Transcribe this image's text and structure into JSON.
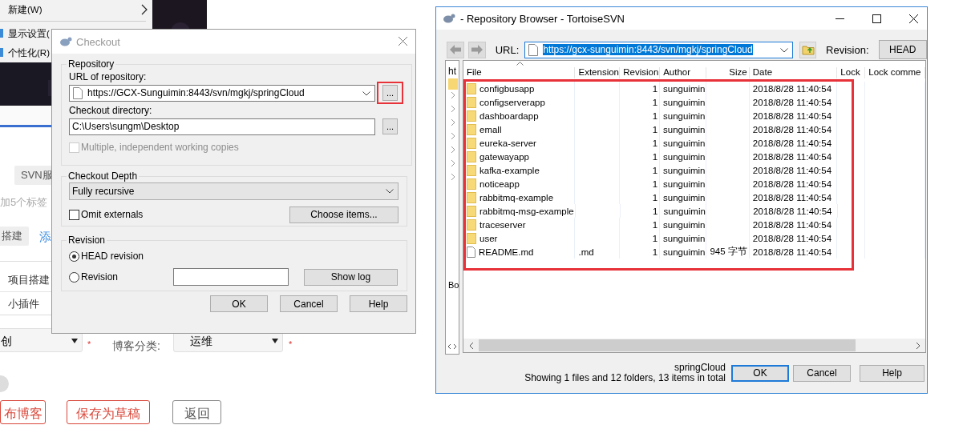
{
  "desktop_menu": {
    "items": [
      {
        "label": "新建(W)",
        "kind": "submenu"
      },
      {
        "label": "显示设置(",
        "kind": "icon"
      },
      {
        "label": "个性化(R)",
        "kind": "icon"
      }
    ]
  },
  "blog_form": {
    "tag": "SVN服",
    "tag_hint": "加5个标签",
    "chosen_tag": "搭建",
    "add_link": "添",
    "categories": [
      "项目搭建",
      "小插件"
    ],
    "type_select": {
      "value": "创",
      "required_mark": "*"
    },
    "category_label": "博客分类:",
    "category_select": {
      "value": "运维",
      "required_mark": "*"
    },
    "buttons": [
      {
        "label": "布博客",
        "kind": "primary"
      },
      {
        "label": "保存为草稿",
        "kind": "primary"
      },
      {
        "label": "返回",
        "kind": "plain"
      }
    ]
  },
  "checkout": {
    "title": "Checkout",
    "repository": {
      "legend": "Repository",
      "url_label": "URL of repository:",
      "url": "https://GCX-Sunguimin:8443/svn/mgkj/springCloud",
      "url_browse": "...",
      "dir_label": "Checkout directory:",
      "dir": "C:\\Users\\sungm\\Desktop",
      "dir_browse": "...",
      "multiple": {
        "label": "Multiple, independent working copies",
        "checked": false,
        "disabled": true
      }
    },
    "depth": {
      "legend": "Checkout Depth",
      "value": "Fully recursive",
      "omit": {
        "label": "Omit externals",
        "checked": false
      },
      "choose": "Choose items..."
    },
    "revision": {
      "legend": "Revision",
      "options": [
        {
          "label": "HEAD revision",
          "selected": true
        },
        {
          "label": "Revision",
          "selected": false
        }
      ],
      "show_log": "Show log"
    },
    "buttons": [
      "OK",
      "Cancel",
      "Help"
    ]
  },
  "repo_browser": {
    "title": "- Repository Browser - TortoiseSVN",
    "url_label": "URL:",
    "url": "https://gcx-sunguimin:8443/svn/mgkj/springCloud",
    "url_selected": true,
    "revision_label": "Revision:",
    "revision": "HEAD",
    "tree": {
      "top": "ht",
      "bottom": "Bo"
    },
    "columns": [
      "File",
      "Extension",
      "Revision",
      "Author",
      "Size",
      "Date",
      "Lock",
      "Lock comme"
    ],
    "rows": [
      {
        "kind": "folder",
        "file": "configbusapp",
        "revision": "1",
        "author": "sunguimin",
        "date": "2018/8/28 11:40:54"
      },
      {
        "kind": "folder",
        "file": "configserverapp",
        "revision": "1",
        "author": "sunguimin",
        "date": "2018/8/28 11:40:54"
      },
      {
        "kind": "folder",
        "file": "dashboardapp",
        "revision": "1",
        "author": "sunguimin",
        "date": "2018/8/28 11:40:54"
      },
      {
        "kind": "folder",
        "file": "emall",
        "revision": "1",
        "author": "sunguimin",
        "date": "2018/8/28 11:40:54"
      },
      {
        "kind": "folder",
        "file": "eureka-server",
        "revision": "1",
        "author": "sunguimin",
        "date": "2018/8/28 11:40:54"
      },
      {
        "kind": "folder",
        "file": "gatewayapp",
        "revision": "1",
        "author": "sunguimin",
        "date": "2018/8/28 11:40:54"
      },
      {
        "kind": "folder",
        "file": "kafka-example",
        "revision": "1",
        "author": "sunguimin",
        "date": "2018/8/28 11:40:54"
      },
      {
        "kind": "folder",
        "file": "noticeapp",
        "revision": "1",
        "author": "sunguimin",
        "date": "2018/8/28 11:40:54"
      },
      {
        "kind": "folder",
        "file": "rabbitmq-example",
        "revision": "1",
        "author": "sunguimin",
        "date": "2018/8/28 11:40:54"
      },
      {
        "kind": "folder",
        "file": "rabbitmq-msg-example",
        "revision": "1",
        "author": "sunguimin",
        "date": "2018/8/28 11:40:54"
      },
      {
        "kind": "folder",
        "file": "traceserver",
        "revision": "1",
        "author": "sunguimin",
        "date": "2018/8/28 11:40:54"
      },
      {
        "kind": "folder",
        "file": "user",
        "revision": "1",
        "author": "sunguimin",
        "date": "2018/8/28 11:40:54"
      },
      {
        "kind": "file",
        "file": "README.md",
        "extension": ".md",
        "revision": "1",
        "author": "sunguimin",
        "size": "945 字节",
        "date": "2018/8/28 11:40:54"
      }
    ],
    "status": {
      "path": "springCloud",
      "summary": "Showing 1 files and 12 folders, 13 items in total"
    },
    "buttons": [
      {
        "label": "OK",
        "default": true
      },
      {
        "label": "Cancel",
        "default": false
      },
      {
        "label": "Help",
        "default": false
      }
    ]
  }
}
